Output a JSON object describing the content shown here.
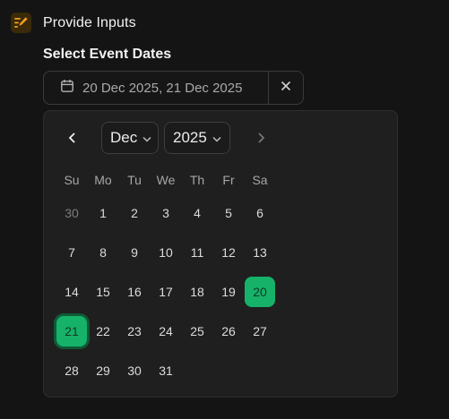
{
  "header": {
    "title": "Provide Inputs",
    "icon": "pencil-list-icon",
    "accent": "#f0a020"
  },
  "field": {
    "label": "Select Event Dates",
    "value": "20 Dec 2025, 21 Dec 2025",
    "icon": "calendar-icon",
    "clear_icon": "close-icon"
  },
  "calendar": {
    "month": "Dec",
    "year": "2025",
    "weekdays": [
      "Su",
      "Mo",
      "Tu",
      "We",
      "Th",
      "Fr",
      "Sa"
    ],
    "weeks": [
      [
        "30",
        "1",
        "2",
        "3",
        "4",
        "5",
        "6"
      ],
      [
        "7",
        "8",
        "9",
        "10",
        "11",
        "12",
        "13"
      ],
      [
        "14",
        "15",
        "16",
        "17",
        "18",
        "19",
        "20"
      ],
      [
        "21",
        "22",
        "23",
        "24",
        "25",
        "26",
        "27"
      ],
      [
        "28",
        "29",
        "30",
        "31"
      ]
    ],
    "outside_days": [
      "0-0"
    ],
    "selected_days": [
      "2-6",
      "3-0"
    ],
    "focused_day": "3-0",
    "selected_color": "#16b26a"
  }
}
